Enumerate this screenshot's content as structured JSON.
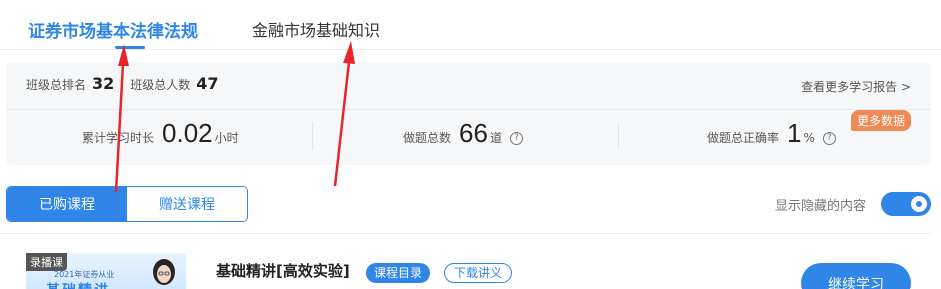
{
  "tabs": [
    {
      "label": "证券市场基本法律法规"
    },
    {
      "label": "金融市场基础知识"
    }
  ],
  "stats": {
    "class_rank_label": "班级总排名",
    "class_rank_value": "32",
    "class_total_label": "班级总人数",
    "class_total_value": "47",
    "report_link": "查看更多学习报告 >",
    "study_time_label": "累计学习时长",
    "study_time_value": "0.02",
    "study_time_unit": "小时",
    "questions_label": "做题总数",
    "questions_value": "66",
    "questions_unit": "道",
    "accuracy_label": "做题总正确率",
    "accuracy_value": "1",
    "accuracy_unit": "%",
    "more_data_badge": "更多数据",
    "help_glyph": "?"
  },
  "course_tabs": {
    "purchased": "已购课程",
    "gifted": "赠送课程"
  },
  "show_hidden": {
    "label": "显示隐藏的内容",
    "enabled": true
  },
  "course": {
    "thumb_tag": "录播课",
    "thumb_subtitle": "2021年证券从业",
    "thumb_title": "基础精讲",
    "title": "基础精讲[高效实验]",
    "catalog_button": "课程目录",
    "download_button": "下载讲义",
    "continue_button": "继续学习"
  },
  "colors": {
    "accent": "#2f86e8",
    "badge": "#f08a54",
    "annotation": "#e8262a"
  }
}
